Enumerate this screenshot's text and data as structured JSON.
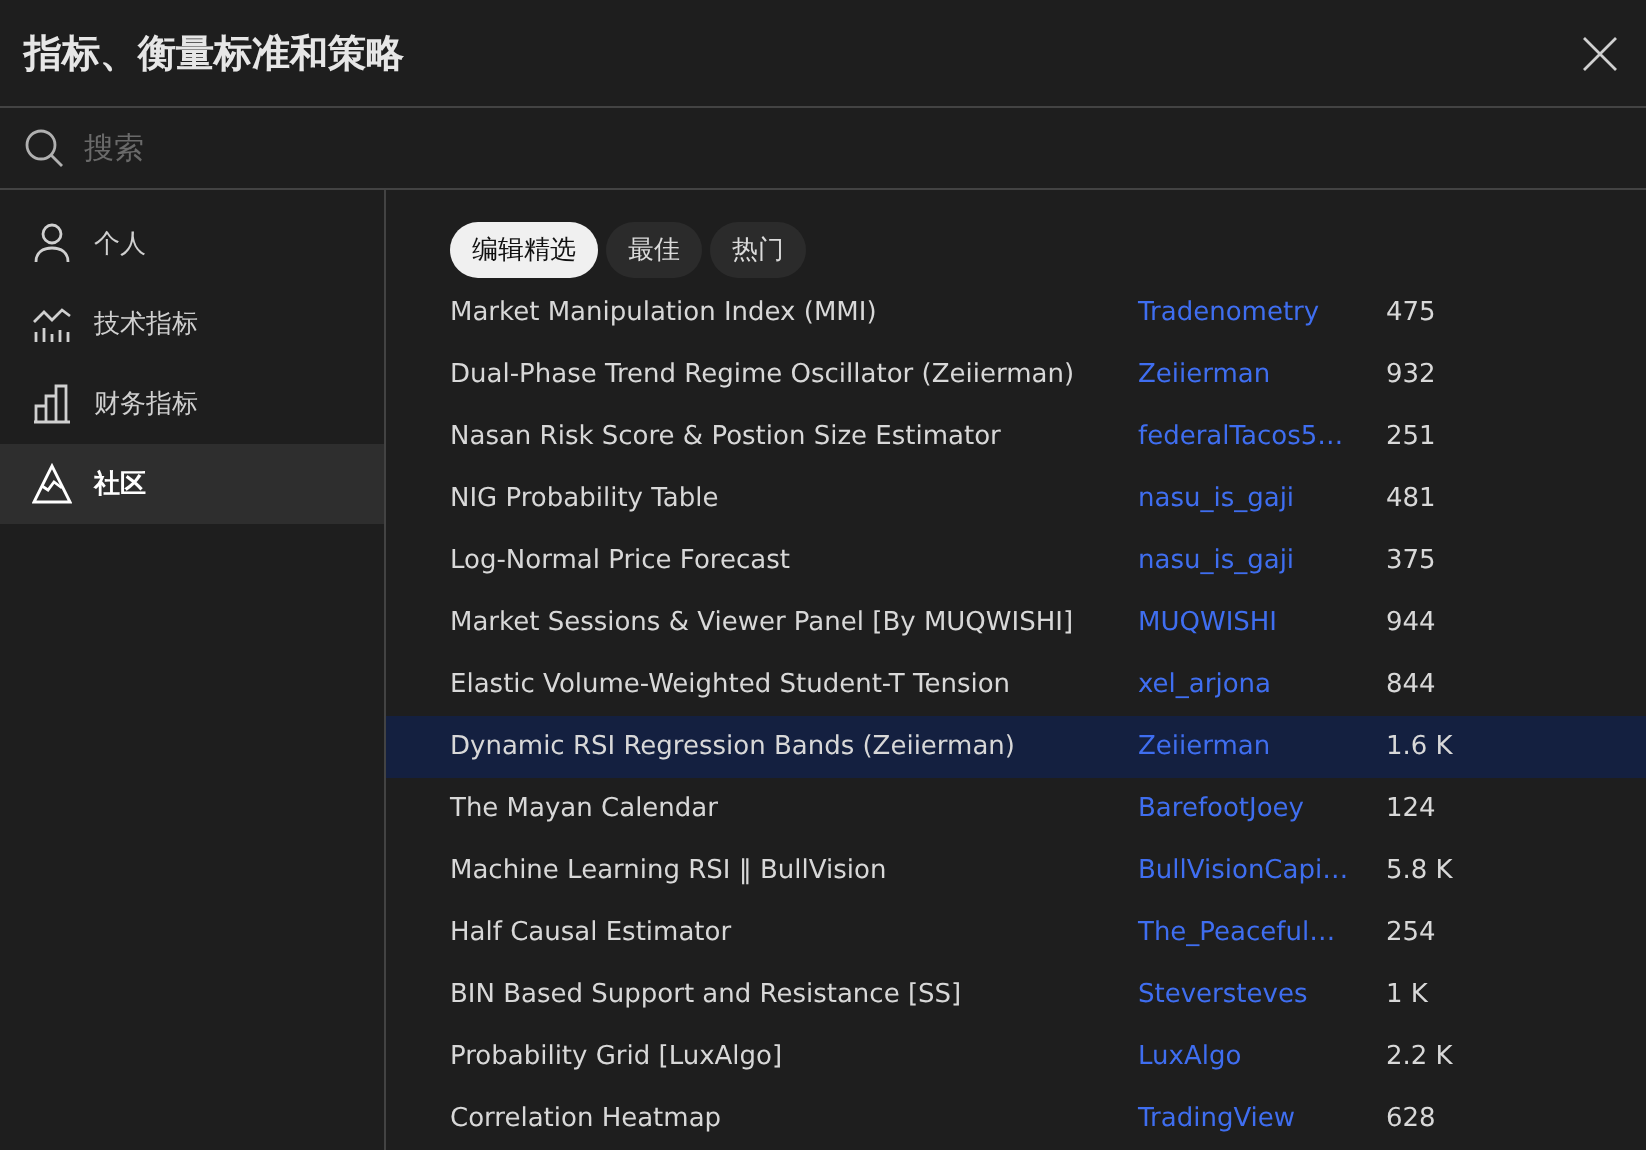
{
  "window": {
    "title": "指标、衡量标准和策略"
  },
  "search": {
    "placeholder": "搜索"
  },
  "sidebar": {
    "items": [
      {
        "label": "个人",
        "kind": "person",
        "selected": false
      },
      {
        "label": "技术指标",
        "kind": "indicator",
        "selected": false
      },
      {
        "label": "财务指标",
        "kind": "bars",
        "selected": false
      },
      {
        "label": "社区",
        "kind": "community",
        "selected": true
      }
    ]
  },
  "tabs": [
    {
      "label": "编辑精选",
      "selected": true
    },
    {
      "label": "最佳",
      "selected": false
    },
    {
      "label": "热门",
      "selected": false
    }
  ],
  "table": {
    "rows": [
      {
        "name": "Market Manipulation Index (MMI)",
        "author": "Tradenometry",
        "count": "475",
        "selected": false
      },
      {
        "name": "Dual-Phase Trend Regime Oscillator (Zeiierman)",
        "author": "Zeiierman",
        "count": "932",
        "selected": false
      },
      {
        "name": "Nasan Risk Score & Postion Size Estimator",
        "author": "federalTacos5…",
        "count": "251",
        "selected": false
      },
      {
        "name": "NIG Probability Table",
        "author": "nasu_is_gaji",
        "count": "481",
        "selected": false
      },
      {
        "name": "Log-Normal Price Forecast",
        "author": "nasu_is_gaji",
        "count": "375",
        "selected": false
      },
      {
        "name": "Market Sessions & Viewer Panel [By MUQWISHI]",
        "author": "MUQWISHI",
        "count": "944",
        "selected": false
      },
      {
        "name": "Elastic Volume-Weighted Student-T Tension",
        "author": "xel_arjona",
        "count": "844",
        "selected": false
      },
      {
        "name": "Dynamic RSI Regression Bands (Zeiierman)",
        "author": "Zeiierman",
        "count": "1.6 K",
        "selected": true
      },
      {
        "name": "The Mayan Calendar",
        "author": "BarefootJoey",
        "count": "124",
        "selected": false
      },
      {
        "name": "Machine Learning RSI ‖ BullVision",
        "author": "BullVisionCapi…",
        "count": "5.8 K",
        "selected": false
      },
      {
        "name": "Half Causal Estimator",
        "author": "The_Peaceful…",
        "count": "254",
        "selected": false
      },
      {
        "name": "BIN Based Support and Resistance [SS]",
        "author": "Steversteves",
        "count": "1 K",
        "selected": false
      },
      {
        "name": "Probability Grid [LuxAlgo]",
        "author": "LuxAlgo",
        "count": "2.2 K",
        "selected": false
      },
      {
        "name": "Correlation Heatmap",
        "author": "TradingView",
        "count": "628",
        "selected": false
      }
    ]
  }
}
